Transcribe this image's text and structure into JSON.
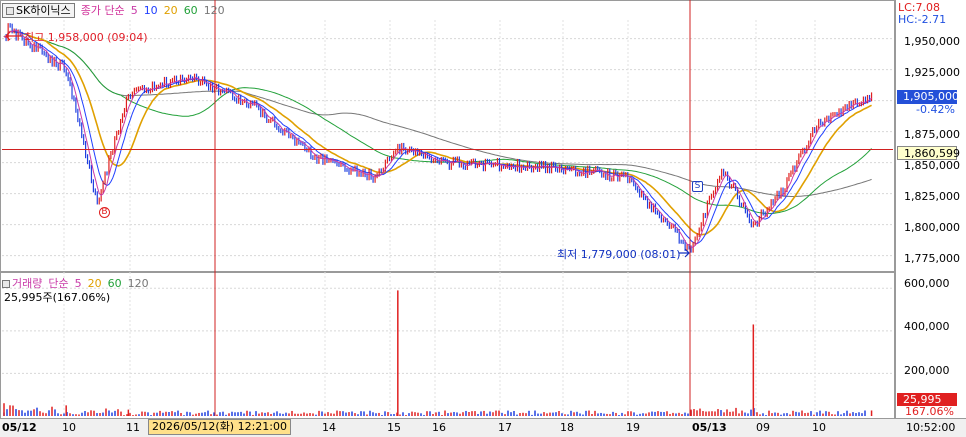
{
  "header": {
    "stock_name": "SK하이닉스",
    "main_label": "종가",
    "ma_label": "단순",
    "ma_periods": [
      "5",
      "10",
      "20",
      "60",
      "120"
    ]
  },
  "annotations": {
    "high": "최고 1,958,000 (09:04)",
    "low": "최저 1,779,000 (08:01)",
    "buy_marker": "B",
    "sell_marker": "S"
  },
  "indicators": {
    "lc": "LC:7.08",
    "hc": "HC:-2.71"
  },
  "price_axis": {
    "ticks": [
      "1,950,000",
      "1,925,000",
      "1,900,000",
      "1,875,000",
      "1,850,000",
      "1,825,000",
      "1,800,000",
      "1,775,000"
    ],
    "current_price": "1,905,000",
    "change_pct": "-0.42%",
    "crosshair_price": "1,860,599"
  },
  "volume_pane": {
    "title": "거래량",
    "ma_label": "단순",
    "ma_periods": [
      "5",
      "20",
      "60",
      "120"
    ],
    "current": "25,995주(167.06%)",
    "ticks": [
      "600,000",
      "400,000",
      "200,000"
    ],
    "current_box": "25,995",
    "current_pct": "167.06%"
  },
  "time_axis": {
    "labels": [
      "05/12",
      "10",
      "11",
      "14",
      "15",
      "16",
      "17",
      "18",
      "19",
      "05/13",
      "09",
      "10"
    ],
    "crosshair_time": "2026/05/12(화) 12:21:00",
    "clock": "10:52:00"
  },
  "colors": {
    "up": "#e02020",
    "down": "#2040e0",
    "ma5": "#c83aa8",
    "ma10": "#2040ff",
    "ma20": "#e0a000",
    "ma60": "#23a13a",
    "ma120": "#777777",
    "crosshair": "#d02020"
  },
  "chart_data": {
    "type": "line",
    "x": [
      "05/12 09:00",
      "05/12 09:04",
      "05/12 10:00",
      "05/12 10:30",
      "05/12 11:00",
      "05/12 12:00",
      "05/12 13:00",
      "05/12 14:00",
      "05/12 15:00",
      "05/12 15:20",
      "05/12 16:00",
      "05/12 17:00",
      "05/12 18:00",
      "05/12 19:00",
      "05/13 08:01",
      "05/13 08:30",
      "05/13 09:00",
      "05/13 09:30",
      "05/13 10:00",
      "05/13 10:52"
    ],
    "series": [
      {
        "name": "종가",
        "values": [
          1948000,
          1958000,
          1925000,
          1818000,
          1905000,
          1920000,
          1897000,
          1855000,
          1838000,
          1862000,
          1850000,
          1848000,
          1846000,
          1838000,
          1779000,
          1845000,
          1800000,
          1830000,
          1880000,
          1905000
        ]
      }
    ],
    "volume": {
      "x": [
        "05/12 09:00",
        "05/12 10:00",
        "05/12 11:00",
        "05/12 15:20",
        "05/13 08:01",
        "05/13 09:00",
        "05/13 10:52"
      ],
      "values": [
        60000,
        50000,
        30000,
        590000,
        30000,
        430000,
        25995
      ]
    },
    "ylim": [
      1765000,
      1965000
    ],
    "volume_ylim": [
      0,
      620000
    ]
  }
}
